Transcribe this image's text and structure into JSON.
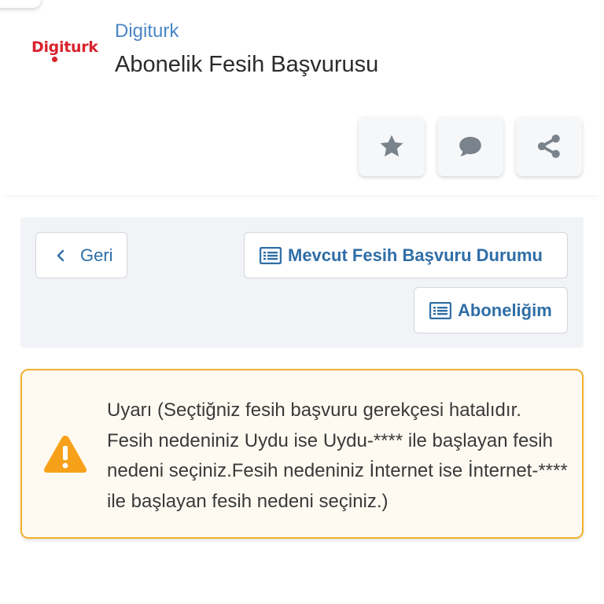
{
  "header": {
    "brand": "Digiturk",
    "title": "Abonelik Fesih Başvurusu",
    "logo_text": "Digiturk"
  },
  "actions": [
    {
      "name": "favorite",
      "icon": "star-icon"
    },
    {
      "name": "comment",
      "icon": "comment-icon"
    },
    {
      "name": "share",
      "icon": "share-icon"
    }
  ],
  "toolbar": {
    "back_label": "Geri",
    "status_label": "Mevcut Fesih Başvuru Durumu",
    "subscription_label": "Aboneliğim"
  },
  "warning": {
    "message": "Uyarı (Seçtiğniz fesih başvuru gerekçesi hatalıdır. Fesih nedeniniz Uydu ise Uydu-**** ile başlayan fesih nedeni seçiniz.Fesih nedeniniz İnternet ise İnternet-**** ile başlayan fesih nedeni seçiniz.)"
  },
  "colors": {
    "accent": "#2f6ea6",
    "brand_red": "#d9232d",
    "warning_border": "#f0b22f",
    "warning_icon": "#f7a11a",
    "icon_gray": "#7a838c"
  }
}
